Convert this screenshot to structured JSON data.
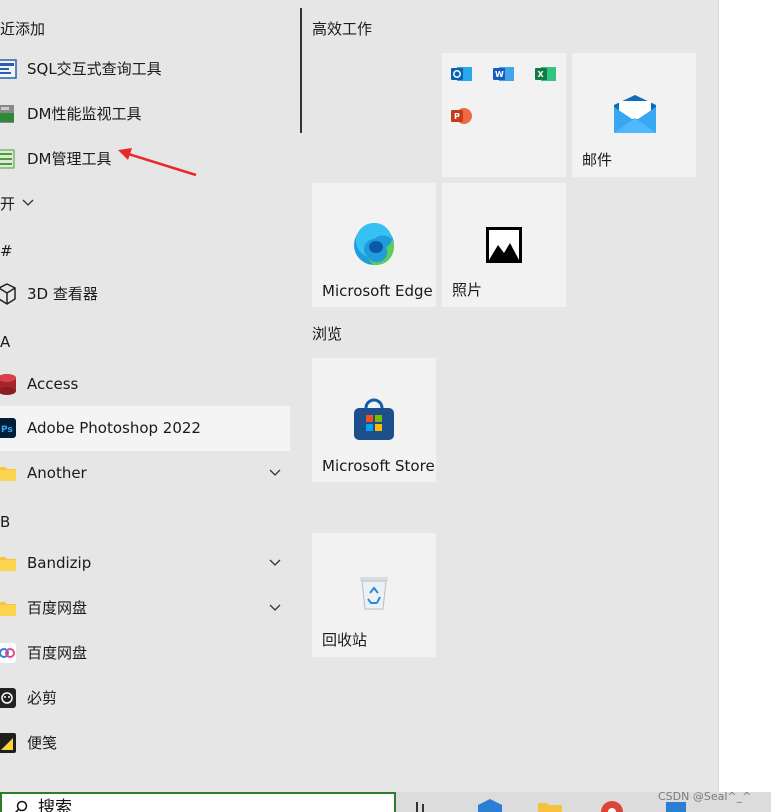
{
  "app_list": {
    "recent_header": "最近添加",
    "recent_header_visible": "近添加",
    "recent": [
      {
        "label": "SQL交互式查询工具",
        "icon": "sql-tool-icon"
      },
      {
        "label": "DM性能监视工具",
        "icon": "dm-monitor-icon"
      },
      {
        "label": "DM管理工具",
        "icon": "dm-admin-icon"
      }
    ],
    "expand_label": "开",
    "groups": [
      {
        "letter": "#",
        "items": [
          {
            "label": "3D 查看器",
            "icon": "cube-3d-icon"
          }
        ]
      },
      {
        "letter": "A",
        "items": [
          {
            "label": "Access",
            "icon": "access-icon"
          },
          {
            "label": "Adobe Photoshop 2022",
            "icon": "photoshop-icon"
          },
          {
            "label": "Another",
            "icon": "folder-icon",
            "expandable": true
          }
        ]
      },
      {
        "letter": "B",
        "items": [
          {
            "label": "Bandizip",
            "icon": "folder-icon",
            "expandable": true
          },
          {
            "label": "百度网盘",
            "icon": "folder-icon",
            "expandable": true
          },
          {
            "label": "百度网盘",
            "icon": "baidu-netdisk-icon"
          },
          {
            "label": "必剪",
            "icon": "bijian-icon"
          },
          {
            "label": "便笺",
            "icon": "sticky-notes-icon"
          }
        ]
      }
    ]
  },
  "tiles": {
    "group1_title": "高效工作",
    "office_icons": [
      "outlook-icon",
      "word-icon",
      "excel-icon",
      "powerpoint-icon"
    ],
    "mail_label": "邮件",
    "edge_label": "Microsoft Edge",
    "photos_label": "照片",
    "group2_title": "浏览",
    "store_label": "Microsoft Store",
    "recycle_label": "回收站"
  },
  "search": {
    "text": "搜索"
  },
  "watermark": "CSDN @Seal^_^",
  "colors": {
    "accent_green": "#2b7d2b",
    "annotation_red": "#e8282b",
    "hover_bg": "#f4f4f4",
    "tile_bg": "#f2f2f2"
  }
}
